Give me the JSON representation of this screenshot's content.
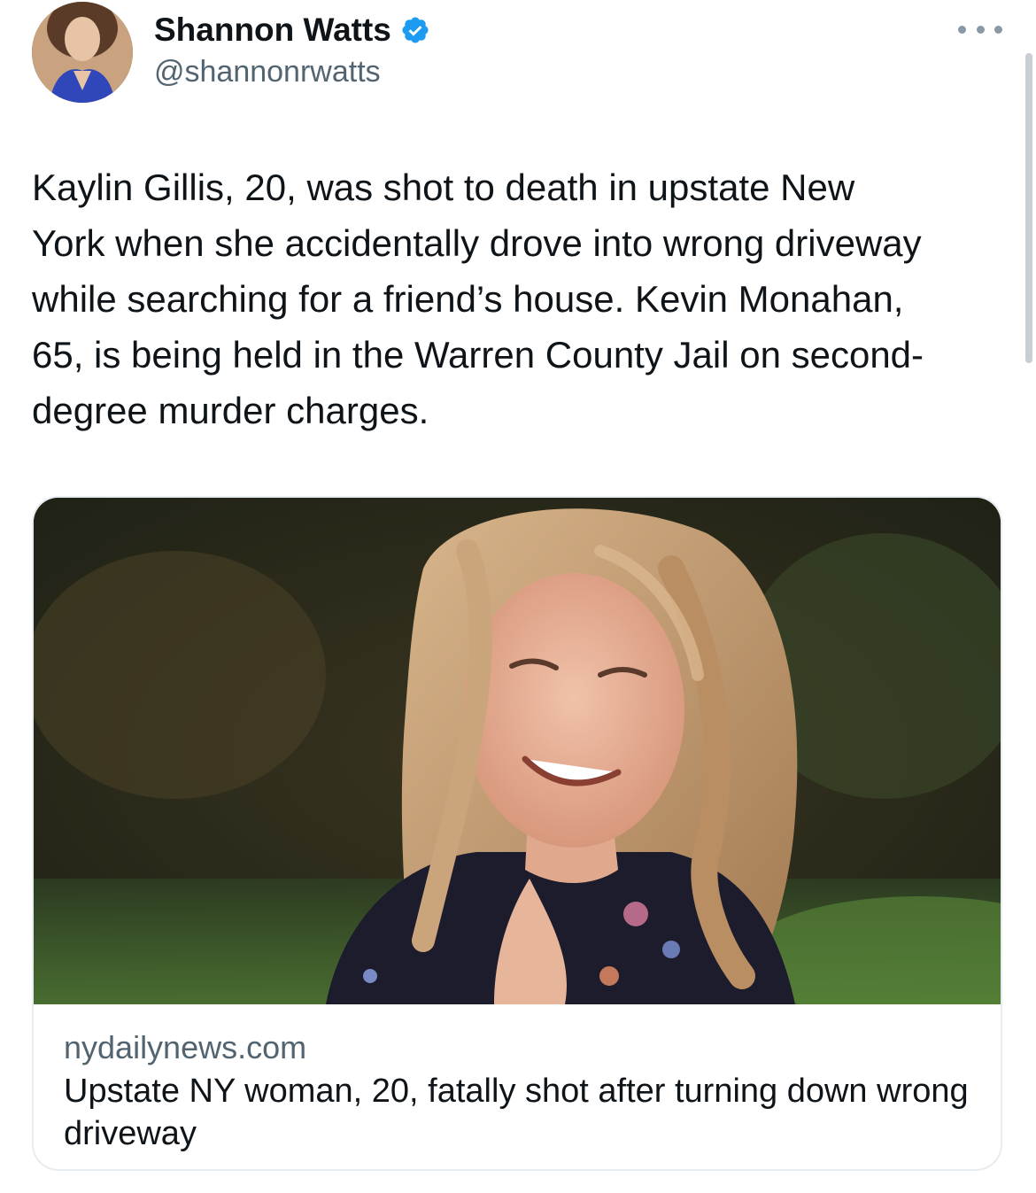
{
  "tweet": {
    "author": {
      "display_name": "Shannon Watts",
      "handle": "@shannonrwatts",
      "verified": true,
      "avatar_icon": "profile-photo"
    },
    "more_icon": "more-horizontal-icon",
    "text": "Kaylin Gillis, 20, was shot to death in upstate New\nYork when she accidentally drove into wrong driveway\nwhile searching for a friend’s house. Kevin Monahan,\n65, is being held in the Warren County Jail on second-\ndegree murder charges.",
    "link_card": {
      "image_icon": "article-photo",
      "domain": "nydailynews.com",
      "title": "Upstate NY woman, 20, fatally shot after turning down wrong driveway"
    }
  },
  "colors": {
    "text_primary": "#0f1419",
    "text_secondary": "#536471",
    "verified_blue": "#1d9bf0",
    "card_border": "#e6ecf0"
  }
}
